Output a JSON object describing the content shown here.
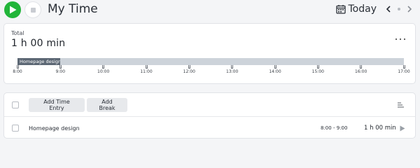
{
  "header": {
    "title": "My Time",
    "date_label": "Today"
  },
  "summary": {
    "total_label": "Total",
    "total_value": "1 h 00 min",
    "timeline": {
      "bar_label": "Homepage design",
      "bar_start": "8:00",
      "bar_end": "9:00",
      "ticks": [
        "8:00",
        "9:00",
        "10:00",
        "11:00",
        "12:00",
        "13:00",
        "14:00",
        "15:00",
        "16:00",
        "17:00"
      ]
    }
  },
  "entries": {
    "add_entry_label": "Add Time Entry",
    "add_break_label": "Add Break",
    "rows": [
      {
        "name": "Homepage design",
        "time_range": "8:00 - 9:00",
        "duration": "1 h 00 min"
      }
    ]
  },
  "colors": {
    "play_green": "#22b53a",
    "timeline_track": "#cdd3da",
    "timeline_bar": "#5c6774"
  }
}
